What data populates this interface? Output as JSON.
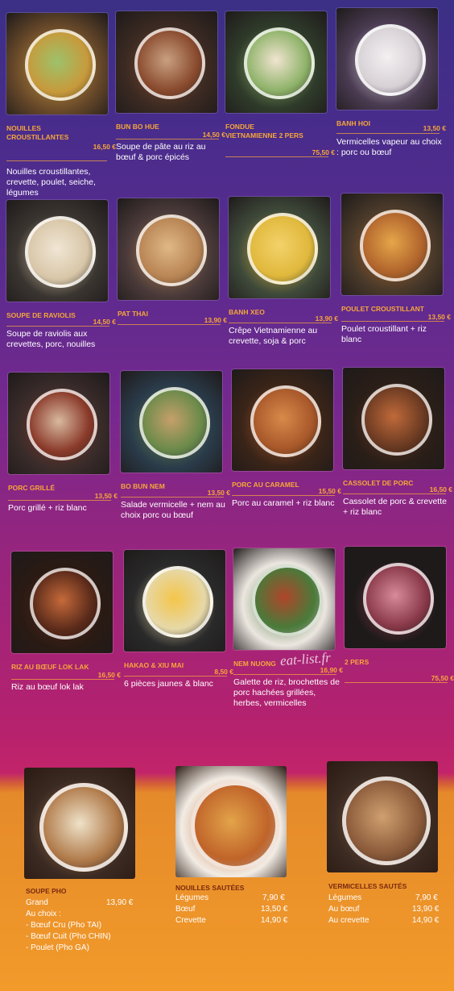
{
  "items": [
    {
      "name": "Nouilles croustillantes",
      "price": "16,50 €",
      "desc": "Nouilles croustillantes, crevette, poulet, seiche, légumes",
      "colors": [
        "#6b4b2a",
        "#c79a3c",
        "#9dc26b"
      ]
    },
    {
      "name": "Bun bo hue",
      "price": "14,50 €",
      "desc": "Soupe de pâte au riz au bœuf & porc épicés",
      "colors": [
        "#3b2a22",
        "#8a4b2f",
        "#c9a081"
      ]
    },
    {
      "name": "Fondue vietnamienne 2 pers",
      "price": "75,50 €",
      "desc": "",
      "colors": [
        "#2f3b2a",
        "#8fb36a",
        "#f1e4d0"
      ]
    },
    {
      "name": "Banh hoi",
      "price": "13,50 €",
      "desc": "Vermicelles vapeur au choix : porc ou bœuf",
      "colors": [
        "#4a3b52",
        "#d7d1d6",
        "#f3f0f1"
      ]
    },
    {
      "name": "Soupe de raviolis",
      "price": "14,50 €",
      "desc": "Soupe de raviolis aux crevettes, porc, nouilles",
      "colors": [
        "#3a3530",
        "#d8c6a8",
        "#f0e6d4"
      ]
    },
    {
      "name": "Pat thai",
      "price": "13,90 €",
      "desc": "",
      "colors": [
        "#4b3b3a",
        "#b88453",
        "#e0b887"
      ]
    },
    {
      "name": "Banh xeo",
      "price": "13,90 €",
      "desc": "Crêpe Vietnamienne au crevette, soja & porc",
      "colors": [
        "#3f4a3a",
        "#e0b83c",
        "#f3d26a"
      ]
    },
    {
      "name": "Poulet croustillant",
      "price": "13,50 €",
      "desc": "Poulet croustillant + riz blanc",
      "colors": [
        "#4a3a2a",
        "#b0642c",
        "#e6a64a"
      ]
    },
    {
      "name": "Porc grillé",
      "price": "13,50 €",
      "desc": "Porc grillé + riz blanc",
      "colors": [
        "#3a2c2a",
        "#8a3a2a",
        "#d9b9a0"
      ]
    },
    {
      "name": "Bo bun nem",
      "price": "13,50 €",
      "desc": "Salade vermicelle + nem au choix porc ou bœuf",
      "colors": [
        "#2a3b4a",
        "#6a8a4a",
        "#c6a06a"
      ]
    },
    {
      "name": "Porc au caramel",
      "price": "15,50 €",
      "desc": "Porc au caramel + riz blanc",
      "colors": [
        "#3a2418",
        "#a8582a",
        "#d88a4a"
      ]
    },
    {
      "name": "Cassolet de porc",
      "price": "16,50 €",
      "desc": "Cassolet de porc & crevette + riz blanc",
      "colors": [
        "#2a1e18",
        "#6a3a22",
        "#c06a3a"
      ]
    },
    {
      "name": "Riz au bœuf lok lak",
      "price": "16,50 €",
      "desc": "Riz au bœuf lok lak",
      "colors": [
        "#2a1a14",
        "#5a2a1a",
        "#c56a3a"
      ]
    },
    {
      "name": "Hakao & xiu mai",
      "price": "8,50 €",
      "desc": "6 pièces jaunes & blanc",
      "colors": [
        "#2a2a2a",
        "#e6d8a8",
        "#f4c54a"
      ]
    },
    {
      "name": "Nem nuong",
      "price": "16,90 €",
      "desc": "Galette de riz, brochettes de porc hachées grillées, herbes, vermicelles",
      "colors": [
        "#ece6e0",
        "#4a7a3a",
        "#b0452a"
      ]
    },
    {
      "name": "2 pers",
      "price": "75,50 €",
      "desc": "",
      "colors": [
        "#1e1a1a",
        "#8a3a4a",
        "#d88a9a"
      ]
    }
  ],
  "watermark": "eat-list.fr",
  "bottom": {
    "pho": {
      "name": "Soupe pho",
      "size_label": "Grand",
      "size_price": "13,90 €",
      "choice_title": "Au choix :",
      "options": [
        "- Bœuf Cru (Pho TAI)",
        "- Bœuf Cuit (Pho CHIN)",
        "- Poulet (Pho GA)"
      ],
      "colors": [
        "#3a2a22",
        "#b07a4a",
        "#efe2c8"
      ]
    },
    "nouilles": {
      "name": "Nouilles sautées",
      "lines": [
        {
          "label": "Légumes",
          "price": "7,90 €"
        },
        {
          "label": "Bœuf",
          "price": "13,50 €"
        },
        {
          "label": "Crevette",
          "price": "14,90 €"
        }
      ],
      "colors": [
        "#f2ece4",
        "#c0642a",
        "#e3a44a"
      ]
    },
    "vermicelles": {
      "name": "Vermicelles sautés",
      "lines": [
        {
          "label": "Légumes",
          "price": "7,90 €"
        },
        {
          "label": "Au bœuf",
          "price": "13,90 €"
        },
        {
          "label": "Au crevette",
          "price": "14,90 €"
        }
      ],
      "colors": [
        "#3a2a22",
        "#8a5a3a",
        "#d0a070"
      ]
    }
  }
}
